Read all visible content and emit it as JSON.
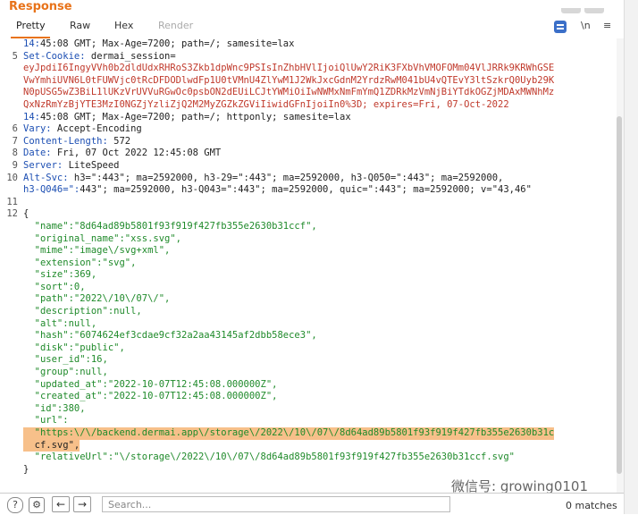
{
  "panel": {
    "title": "Response"
  },
  "tabs": [
    {
      "label": "Pretty",
      "active": true
    },
    {
      "label": "Raw"
    },
    {
      "label": "Hex"
    },
    {
      "label": "Render",
      "disabled": true
    }
  ],
  "controls": {
    "newline": "\\n",
    "menu": "≡"
  },
  "lines": [
    {
      "ln": "",
      "text": "14:45:08 GMT; Max-Age=7200; path=/; samesite=lax"
    },
    {
      "ln": "5",
      "text": "Set-Cookie: dermai_session="
    },
    {
      "ln": "",
      "text": "eyJpdiI6IngyVVh0b2dldUdxRHRoS3Zkb1dpWnc9PSIsInZhbHVlIjoiQlUwY2RiK3FXbVhVMOFOMm04VlJRRk9KRWhGSE"
    },
    {
      "ln": "",
      "text": "VwYmhiUVN6L0tFUWVjc0tRcDFDODlwdFp1U0tVMnU4ZlYwM1J2WkJxcGdnM2YrdzRwM041bU4vQTEvY3ltSzkrQ0Uyb29K"
    },
    {
      "ln": "",
      "text": "N0pUSG5wZ3BiL1lUKzVrUVVuRGwOc0psbON2dEUiLCJtYWMiOiIwNWMxNmFmYmQ1ZDRkMzVmNjBiYTdkOGZjMDAxMWNhMz"
    },
    {
      "ln": "",
      "text": "QxNzRmYzBjYTE3MzI0NGZjYzliZjQ2M2MyZGZkZGViIiwidGFnIjoiIn0%3D; expires=Fri, 07-Oct-2022"
    },
    {
      "ln": "",
      "text": "14:45:08 GMT; Max-Age=7200; path=/; httponly; samesite=lax"
    },
    {
      "ln": "6",
      "text": "Vary: Accept-Encoding"
    },
    {
      "ln": "7",
      "text": "Content-Length: 572"
    },
    {
      "ln": "8",
      "text": "Date: Fri, 07 Oct 2022 12:45:08 GMT"
    },
    {
      "ln": "9",
      "text": "Server: LiteSpeed"
    },
    {
      "ln": "10",
      "text": "Alt-Svc: h3=\":443\"; ma=2592000, h3-29=\":443\"; ma=2592000, h3-Q050=\":443\"; ma=2592000,"
    },
    {
      "ln": "",
      "text": "h3-Q046=\":443\"; ma=2592000, h3-Q043=\":443\"; ma=2592000, quic=\":443\"; ma=2592000; v=\"43,46\""
    },
    {
      "ln": "11",
      "text": ""
    },
    {
      "ln": "12",
      "text": "{"
    },
    {
      "ln": "",
      "text": "  \"name\":\"8d64ad89b5801f93f919f427fb355e2630b31ccf\","
    },
    {
      "ln": "",
      "text": "  \"original_name\":\"xss.svg\","
    },
    {
      "ln": "",
      "text": "  \"mime\":\"image\\/svg+xml\","
    },
    {
      "ln": "",
      "text": "  \"extension\":\"svg\","
    },
    {
      "ln": "",
      "text": "  \"size\":369,"
    },
    {
      "ln": "",
      "text": "  \"sort\":0,"
    },
    {
      "ln": "",
      "text": "  \"path\":\"2022\\/10\\/07\\/\","
    },
    {
      "ln": "",
      "text": "  \"description\":null,"
    },
    {
      "ln": "",
      "text": "  \"alt\":null,"
    },
    {
      "ln": "",
      "text": "  \"hash\":\"6074624ef3cdae9cf32a2aa43145af2dbb58ece3\","
    },
    {
      "ln": "",
      "text": "  \"disk\":\"public\","
    },
    {
      "ln": "",
      "text": "  \"user_id\":16,"
    },
    {
      "ln": "",
      "text": "  \"group\":null,"
    },
    {
      "ln": "",
      "text": "  \"updated_at\":\"2022-10-07T12:45:08.000000Z\","
    },
    {
      "ln": "",
      "text": "  \"created_at\":\"2022-10-07T12:45:08.000000Z\","
    },
    {
      "ln": "",
      "text": "  \"id\":380,"
    },
    {
      "ln": "",
      "text": "  \"url\":"
    },
    {
      "ln": "",
      "text": "  \"https:\\/\\/backend.dermai.app\\/storage\\/2022\\/10\\/07\\/8d64ad89b5801f93f919f427fb355e2630b31c",
      "highlight": true
    },
    {
      "ln": "",
      "text": "  cf.svg\",",
      "highlight": true
    },
    {
      "ln": "",
      "text": "  \"relativeUrl\":\"\\/storage\\/2022\\/10\\/07\\/8d64ad89b5801f93f919f427fb355e2630b31ccf.svg\""
    },
    {
      "ln": "",
      "text": "}"
    }
  ],
  "bottom": {
    "search_placeholder": "Search...",
    "matches": "0 matches"
  },
  "watermark": "微信号: growing0101",
  "colors": {
    "accent": "#e8731a",
    "key": "#1d4fb3",
    "string": "#1f8a2a",
    "cookie": "#c0392b",
    "highlight": "#f7c08a"
  }
}
